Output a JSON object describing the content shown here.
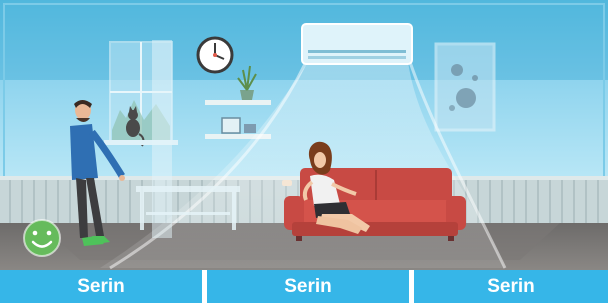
{
  "scene": {
    "description_icons": [
      "man-figure",
      "woman-figure",
      "sofa",
      "air-conditioner",
      "wall-clock",
      "window-with-cat",
      "glass-table",
      "wall-shelves",
      "framed-picture",
      "smiley-icon"
    ],
    "colors": {
      "wall": "#a9e3f6",
      "wall_top": "#4fb8dd",
      "floor": "#6f6f6f",
      "sofa": "#c84a44",
      "tab_bg": "#36b6e8",
      "smiley_bg": "#66bb5c"
    }
  },
  "tabs": [
    {
      "label": "Serin"
    },
    {
      "label": "Serin"
    },
    {
      "label": "Serin"
    }
  ]
}
